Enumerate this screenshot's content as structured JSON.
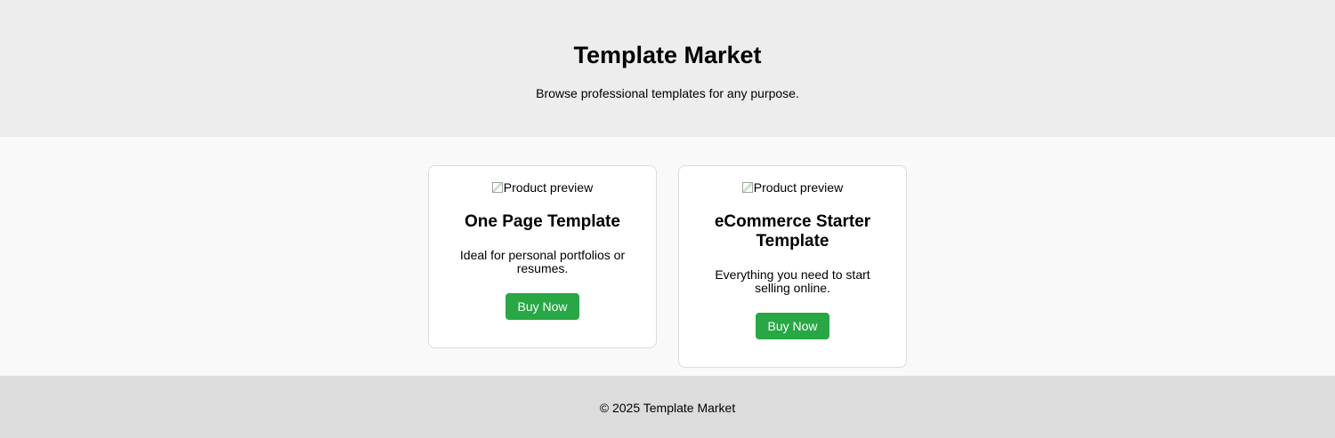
{
  "header": {
    "title": "Template Market",
    "subtitle": "Browse professional templates for any purpose."
  },
  "products": [
    {
      "image_alt": "Product preview",
      "title": "One Page Template",
      "description": "Ideal for personal portfolios or resumes.",
      "button_label": "Buy Now"
    },
    {
      "image_alt": "Product preview",
      "title": "eCommerce Starter Template",
      "description": "Everything you need to start selling online.",
      "button_label": "Buy Now"
    }
  ],
  "footer": {
    "text": "© 2025 Template Market"
  },
  "colors": {
    "header_bg": "#ededed",
    "main_bg": "#f9f9f9",
    "footer_bg": "#dcdcdc",
    "button_bg": "#28a745"
  }
}
